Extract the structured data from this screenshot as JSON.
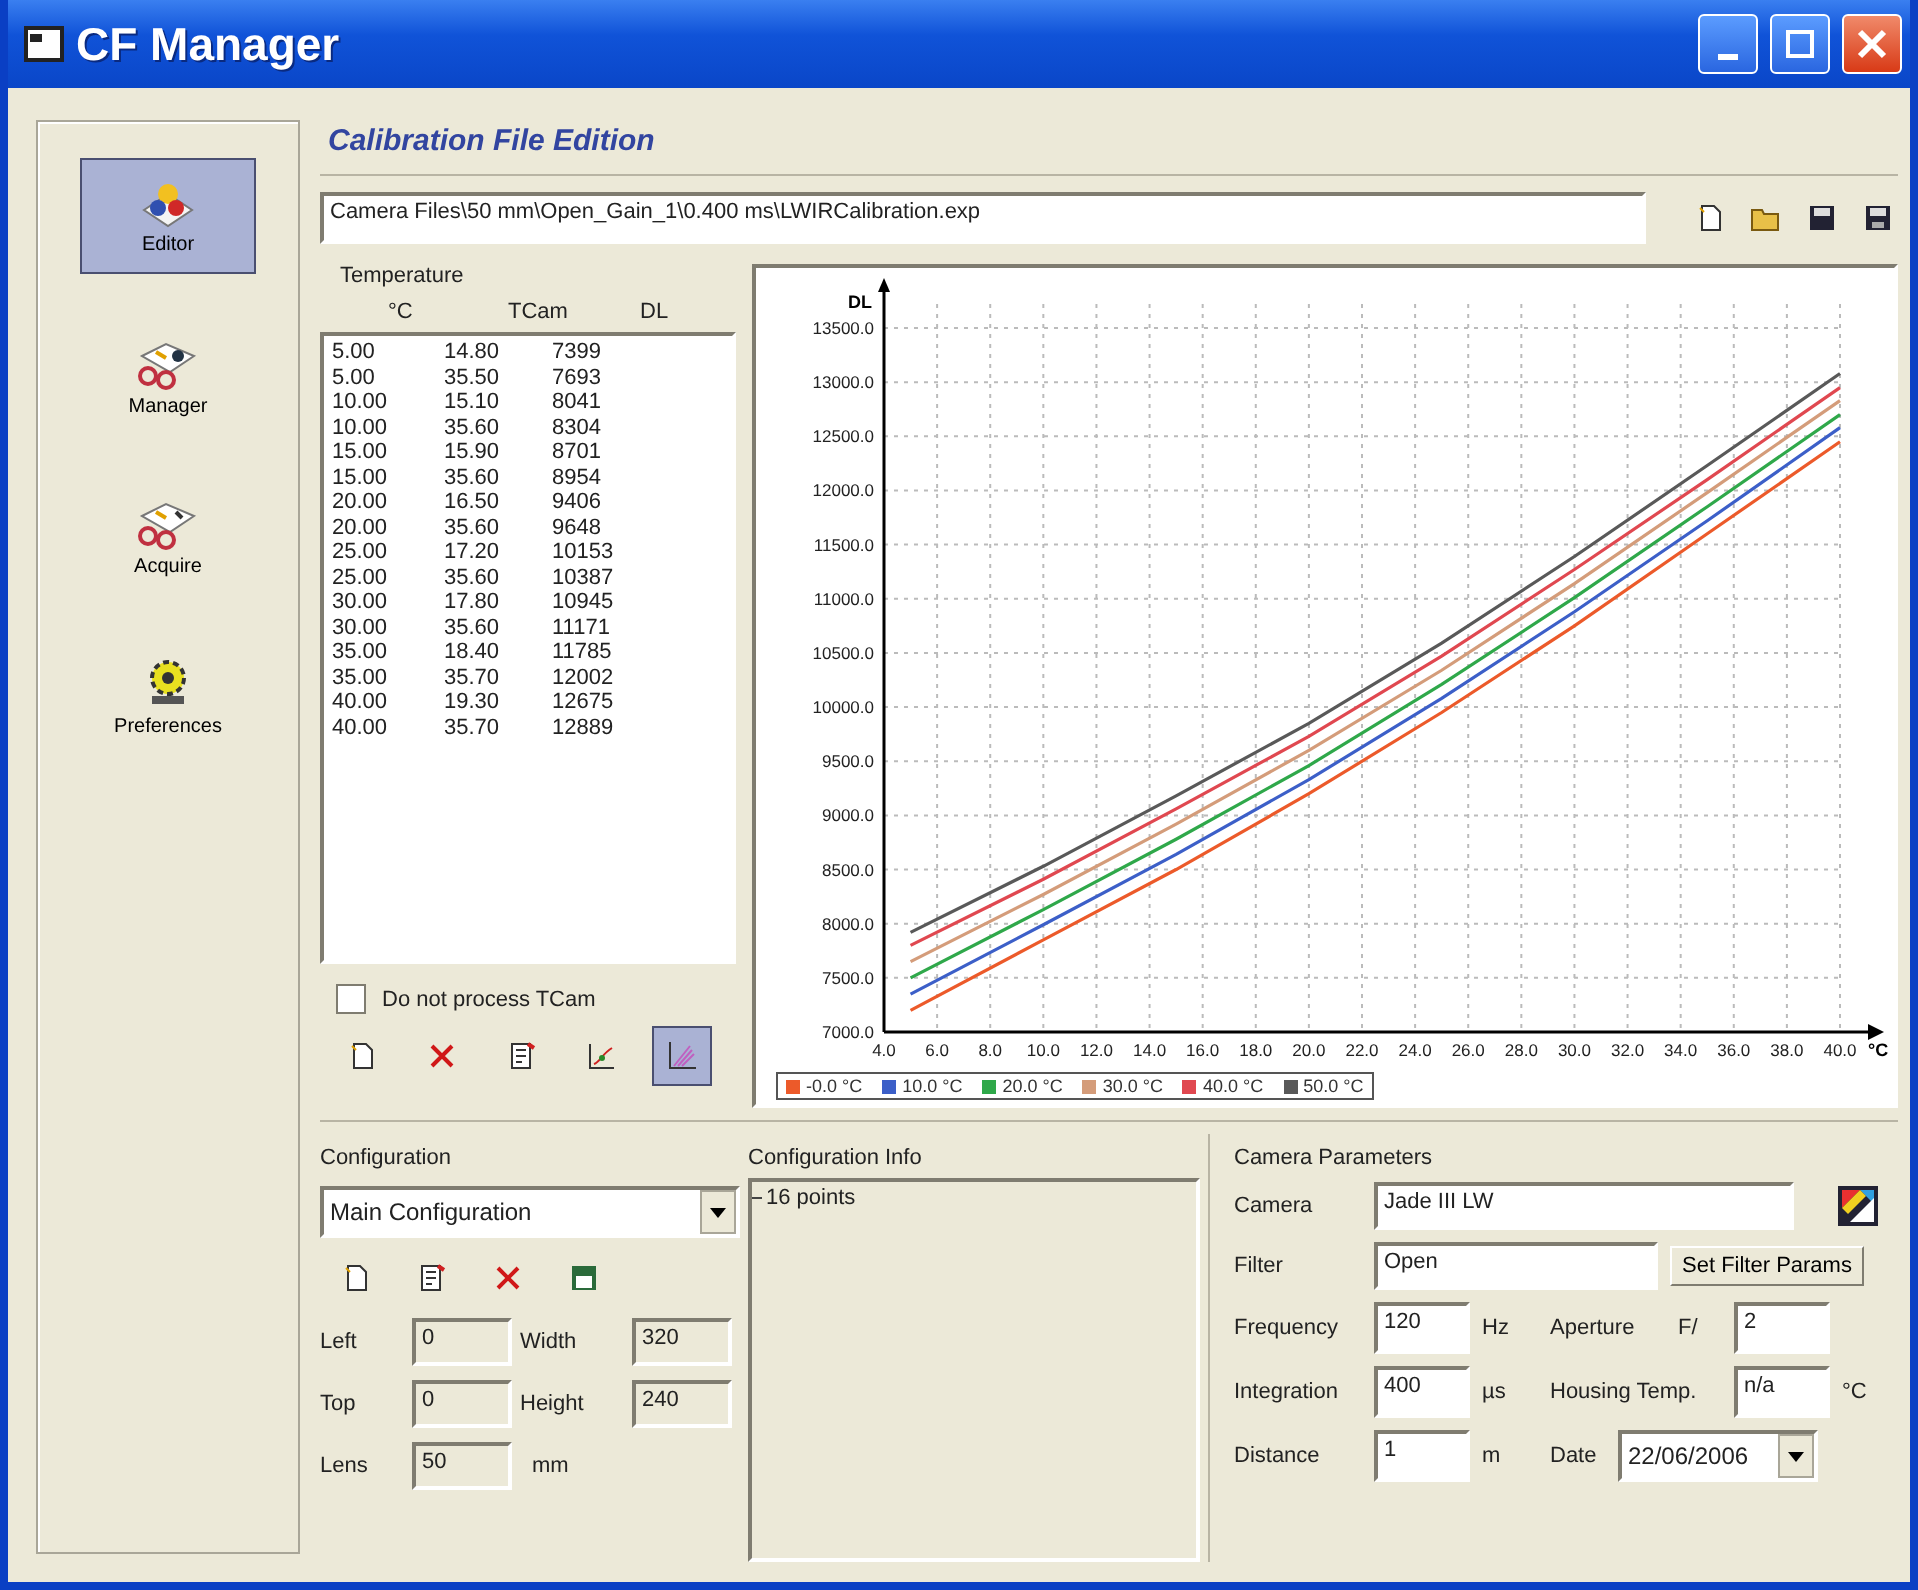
{
  "window": {
    "title": "CF Manager"
  },
  "sidebar": {
    "items": [
      {
        "label": "Editor",
        "kind": "editor",
        "selected": true
      },
      {
        "label": "Manager",
        "kind": "manager",
        "selected": false
      },
      {
        "label": "Acquire",
        "kind": "acquire",
        "selected": false
      },
      {
        "label": "Preferences",
        "kind": "preferences",
        "selected": false
      }
    ]
  },
  "header": {
    "title": "Calibration File Edition"
  },
  "file_path": "Camera Files\\50 mm\\Open_Gain_1\\0.400 ms\\LWIRCalibration.exp",
  "file_tools": [
    {
      "kind": "new"
    },
    {
      "kind": "open"
    },
    {
      "kind": "save"
    },
    {
      "kind": "save-as"
    }
  ],
  "temperature": {
    "title": "Temperature",
    "columns": [
      "°C",
      "TCam",
      "DL"
    ],
    "rows": [
      [
        "5.00",
        "14.80",
        "7399"
      ],
      [
        "5.00",
        "35.50",
        "7693"
      ],
      [
        "10.00",
        "15.10",
        "8041"
      ],
      [
        "10.00",
        "35.60",
        "8304"
      ],
      [
        "15.00",
        "15.90",
        "8701"
      ],
      [
        "15.00",
        "35.60",
        "8954"
      ],
      [
        "20.00",
        "16.50",
        "9406"
      ],
      [
        "20.00",
        "35.60",
        "9648"
      ],
      [
        "25.00",
        "17.20",
        "10153"
      ],
      [
        "25.00",
        "35.60",
        "10387"
      ],
      [
        "30.00",
        "17.80",
        "10945"
      ],
      [
        "30.00",
        "35.60",
        "11171"
      ],
      [
        "35.00",
        "18.40",
        "11785"
      ],
      [
        "35.00",
        "35.70",
        "12002"
      ],
      [
        "40.00",
        "19.30",
        "12675"
      ],
      [
        "40.00",
        "35.70",
        "12889"
      ]
    ]
  },
  "do_not_process": {
    "label": "Do not process TCam",
    "checked": false
  },
  "list_tools": [
    {
      "kind": "new",
      "selected": false
    },
    {
      "kind": "delete",
      "selected": false
    },
    {
      "kind": "edit",
      "selected": false
    },
    {
      "kind": "fit",
      "selected": false
    },
    {
      "kind": "chart",
      "selected": true
    }
  ],
  "chart": {
    "chart_data": {
      "type": "line",
      "grid": true,
      "ylabel": "DL",
      "xlabel": "°C",
      "x": [
        5,
        10,
        15,
        20,
        25,
        30,
        35,
        40
      ],
      "xlim": [
        4,
        40
      ],
      "ylim": [
        7000,
        13500
      ],
      "xticks": [
        {
          "value": 4,
          "label": "4.0"
        },
        {
          "value": 6,
          "label": "6.0"
        },
        {
          "value": 8,
          "label": "8.0"
        },
        {
          "value": 10,
          "label": "10.0"
        },
        {
          "value": 12,
          "label": "12.0"
        },
        {
          "value": 14,
          "label": "14.0"
        },
        {
          "value": 16,
          "label": "16.0"
        },
        {
          "value": 18,
          "label": "18.0"
        },
        {
          "value": 20,
          "label": "20.0"
        },
        {
          "value": 22,
          "label": "22.0"
        },
        {
          "value": 24,
          "label": "24.0"
        },
        {
          "value": 26,
          "label": "26.0"
        },
        {
          "value": 28,
          "label": "28.0"
        },
        {
          "value": 30,
          "label": "30.0"
        },
        {
          "value": 32,
          "label": "32.0"
        },
        {
          "value": 34,
          "label": "34.0"
        },
        {
          "value": 36,
          "label": "36.0"
        },
        {
          "value": 38,
          "label": "38.0"
        },
        {
          "value": 40,
          "label": "40.0"
        }
      ],
      "yticks": [
        {
          "value": 7000,
          "label": "7000.0"
        },
        {
          "value": 7500,
          "label": "7500.0"
        },
        {
          "value": 8000,
          "label": "8000.0"
        },
        {
          "value": 8500,
          "label": "8500.0"
        },
        {
          "value": 9000,
          "label": "9000.0"
        },
        {
          "value": 9500,
          "label": "9500.0"
        },
        {
          "value": 10000,
          "label": "10000.0"
        },
        {
          "value": 10500,
          "label": "10500.0"
        },
        {
          "value": 11000,
          "label": "11000.0"
        },
        {
          "value": 11500,
          "label": "11500.0"
        },
        {
          "value": 12000,
          "label": "12000.0"
        },
        {
          "value": 12500,
          "label": "12500.0"
        },
        {
          "value": 13000,
          "label": "13000.0"
        },
        {
          "value": 13500,
          "label": "13500.0"
        }
      ],
      "series": [
        {
          "name": "-0.0 °C",
          "color": "#ec5a2a",
          "values": [
            7200,
            7850,
            8500,
            9200,
            9950,
            10750,
            11600,
            12450
          ]
        },
        {
          "name": "10.0 °C",
          "color": "#3c5fc8",
          "values": [
            7350,
            7990,
            8640,
            9330,
            10080,
            10880,
            11720,
            12580
          ]
        },
        {
          "name": "20.0 °C",
          "color": "#2fa84a",
          "values": [
            7500,
            8130,
            8780,
            9460,
            10210,
            11010,
            11850,
            12700
          ]
        },
        {
          "name": "30.0 °C",
          "color": "#d49c7a",
          "values": [
            7650,
            8270,
            8920,
            9600,
            10340,
            11140,
            11980,
            12830
          ]
        },
        {
          "name": "40.0 °C",
          "color": "#e04850",
          "values": [
            7800,
            8410,
            9060,
            9730,
            10470,
            11270,
            12100,
            12950
          ]
        },
        {
          "name": "50.0 °C",
          "color": "#595959",
          "values": [
            7920,
            8530,
            9180,
            9850,
            10590,
            11390,
            12230,
            13080
          ]
        }
      ]
    }
  },
  "configuration": {
    "title": "Configuration",
    "selected_value": "Main Configuration",
    "tools": [
      {
        "kind": "new"
      },
      {
        "kind": "edit"
      },
      {
        "kind": "delete"
      },
      {
        "kind": "export"
      }
    ],
    "fields": [
      {
        "label": "Left",
        "value": "0",
        "disabled": true
      },
      {
        "label": "Width",
        "value": "320",
        "disabled": true
      },
      {
        "label": "Top",
        "value": "0",
        "disabled": true
      },
      {
        "label": "Height",
        "value": "240",
        "disabled": true
      },
      {
        "label": "Lens",
        "value": "50",
        "unit": "mm",
        "disabled": true
      }
    ]
  },
  "configuration_info": {
    "title": "Configuration Info",
    "items": [
      "16 points"
    ]
  },
  "camera_parameters": {
    "title": "Camera Parameters",
    "camera": {
      "label": "Camera",
      "value": "Jade III LW"
    },
    "filter": {
      "label": "Filter",
      "value": "Open",
      "button": "Set Filter Params"
    },
    "frequency": {
      "label": "Frequency",
      "value": "120",
      "unit": "Hz"
    },
    "aperture": {
      "label": "Aperture",
      "prefix": "F/",
      "value": "2"
    },
    "integration": {
      "label": "Integration",
      "value": "400",
      "unit": "µs"
    },
    "housing_temp": {
      "label": "Housing Temp.",
      "value": "n/a",
      "unit": "°C"
    },
    "distance": {
      "label": "Distance",
      "value": "1",
      "unit": "m"
    },
    "date": {
      "label": "Date",
      "value": "22/06/2006"
    }
  }
}
